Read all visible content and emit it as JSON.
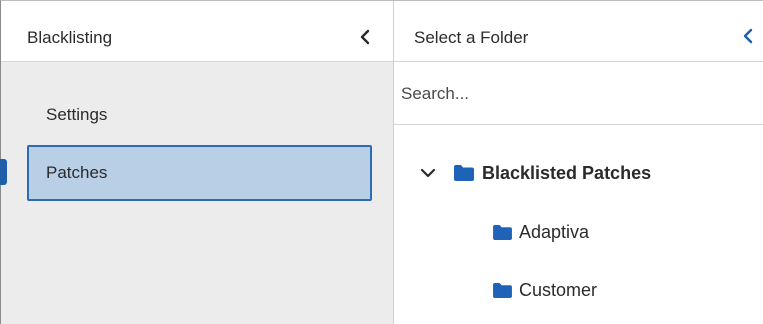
{
  "left_panel": {
    "title": "Blacklisting",
    "collapse_icon": "chevron-left-icon",
    "nav_items": [
      {
        "label": "Settings",
        "active": false
      },
      {
        "label": "Patches",
        "active": true
      }
    ]
  },
  "right_panel": {
    "title": "Select a Folder",
    "collapse_icon": "chevron-left-icon",
    "search": {
      "placeholder": "Search...",
      "value": ""
    },
    "tree": {
      "root": {
        "label": "Blacklisted Patches",
        "expanded": true,
        "icon": "folder-icon"
      },
      "children": [
        {
          "label": "Adaptiva",
          "icon": "folder-icon"
        },
        {
          "label": "Customer",
          "icon": "folder-icon"
        }
      ]
    }
  },
  "colors": {
    "accent": "#1f5ea8",
    "active_bg": "#b9cfe6",
    "active_border": "#2b6cb5",
    "panel_bg": "#ececec",
    "folder": "#1e63b8"
  }
}
